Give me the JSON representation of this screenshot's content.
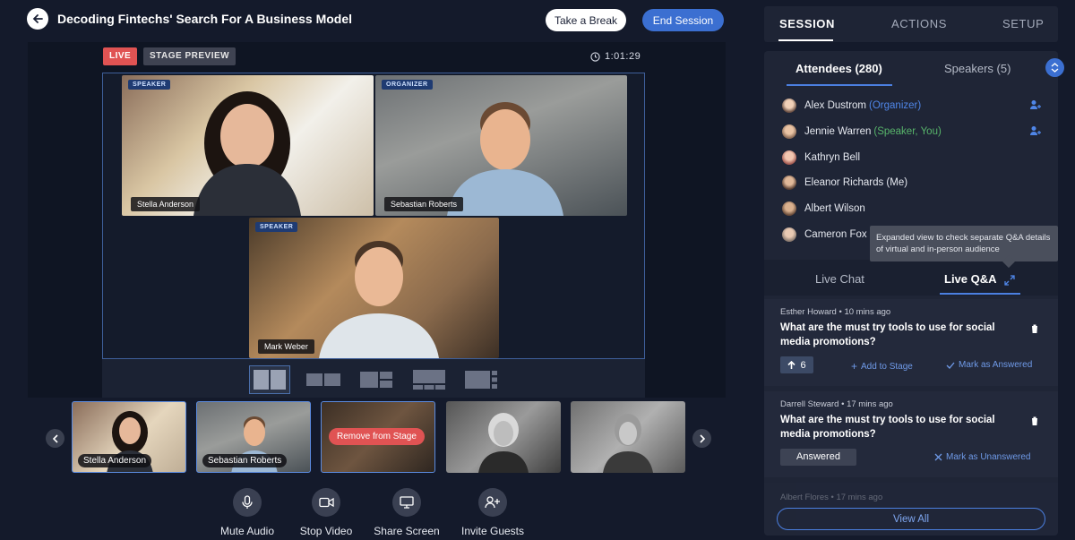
{
  "session": {
    "title": "Decoding Fintechs' Search For A Business Model",
    "take_break_label": "Take a Break",
    "end_session_label": "End Session"
  },
  "stage": {
    "live_label": "LIVE",
    "preview_label": "STAGE PREVIEW",
    "timer": "1:01:29",
    "videos": [
      {
        "role": "SPEAKER",
        "name": "Stella Anderson"
      },
      {
        "role": "ORGANIZER",
        "name": "Sebastian Roberts"
      },
      {
        "role": "SPEAKER",
        "name": "Mark Weber"
      }
    ]
  },
  "thumbnails": [
    {
      "name": "Stella Anderson"
    },
    {
      "name": "Sebastian Roberts"
    },
    {
      "name": "",
      "action_label": "Remove from Stage"
    },
    {
      "name": ""
    },
    {
      "name": ""
    }
  ],
  "controls": {
    "mute_audio": "Mute Audio",
    "stop_video": "Stop Video",
    "share_screen": "Share Screen",
    "invite_guests": "Invite Guests"
  },
  "right_panel": {
    "tabs": [
      "SESSION",
      "ACTIONS",
      "SETUP"
    ],
    "attendees_tab": "Attendees (280)",
    "speakers_tab": "Speakers (5)",
    "attendees": [
      {
        "name": "Alex Dustrom",
        "sub": "(Organizer)"
      },
      {
        "name": "Jennie Warren",
        "sub": "(Speaker, You)"
      },
      {
        "name": "Kathryn Bell",
        "sub": ""
      },
      {
        "name": "Eleanor Richards (Me)",
        "sub": ""
      },
      {
        "name": "Albert Wilson",
        "sub": ""
      },
      {
        "name": "Cameron Fox",
        "sub": ""
      }
    ],
    "tooltip": "Expanded view to check separate Q&A details of virtual and in-person audience",
    "chat_tabs": [
      "Live Chat",
      "Live Q&A"
    ],
    "questions": [
      {
        "author": "Esther Howard",
        "time": "10 mins ago",
        "question": "What are the must try tools to use for social media promotions?",
        "votes": "6",
        "add_to_stage": "Add to Stage",
        "mark_label": "Mark as Answered"
      },
      {
        "author": "Darrell Steward",
        "time": "17 mins ago",
        "question": "What are the must try tools to use for social media promotions?",
        "status": "Answered",
        "mark_label": "Mark as Unanswered"
      },
      {
        "author": "Albert Flores",
        "time": "17 mins ago"
      }
    ],
    "view_all_label": "View All"
  },
  "colors": {
    "background": "#141a2b",
    "accent": "#3b6fd1",
    "live": "#e05353",
    "organizer": "#4f86e8",
    "speaker": "#58b56b"
  }
}
